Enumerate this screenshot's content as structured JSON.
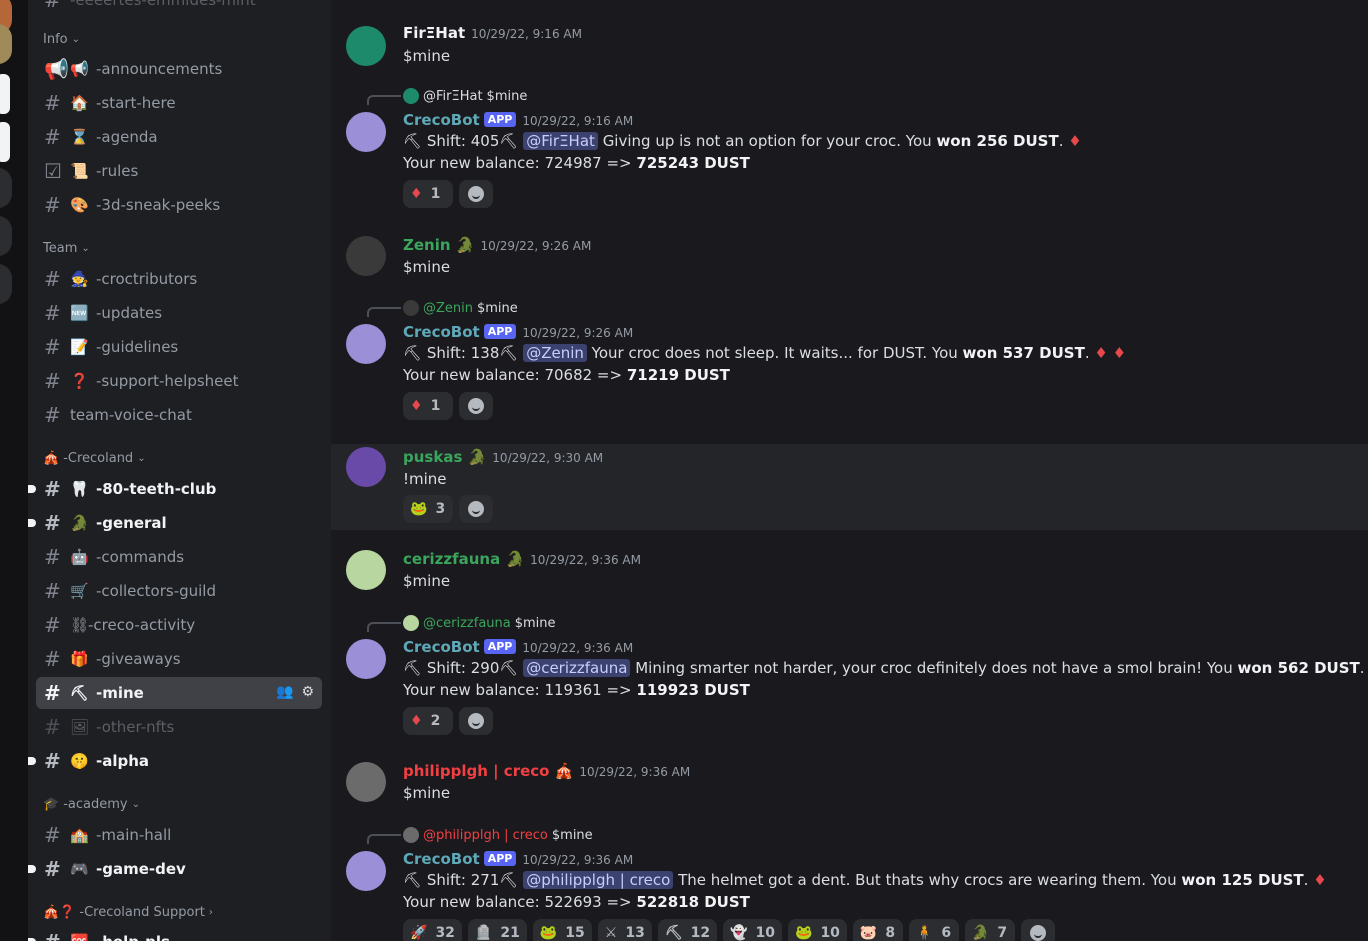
{
  "sidebar": {
    "cut_label": "-eeeertes-emmides-mint",
    "categories": [
      {
        "label": "Info"
      },
      {
        "label": "Team"
      },
      {
        "label": "-Crecoland",
        "emoji": "🎪"
      },
      {
        "label": "-academy",
        "emoji": "🎓"
      },
      {
        "label": "-Crecoland Support",
        "emoji": "🎪❓"
      }
    ],
    "channels": [
      {
        "emoji": "📢",
        "label": "-announcements",
        "icon": "megaphone-icon"
      },
      {
        "emoji": "🏠",
        "label": "-start-here"
      },
      {
        "emoji": "⌛",
        "label": "-agenda"
      },
      {
        "emoji": "📜",
        "label": "-rules",
        "icon": "checkbox-icon"
      },
      {
        "emoji": "🎨",
        "label": "-3d-sneak-peeks"
      },
      {
        "emoji": "🧙",
        "label": "-croctributors"
      },
      {
        "emoji": "🆕",
        "label": "-updates"
      },
      {
        "emoji": "📝",
        "label": "-guidelines"
      },
      {
        "emoji": "❓",
        "label": "-support-helpsheet"
      },
      {
        "emoji": "",
        "label": "team-voice-chat"
      },
      {
        "emoji": "🦷",
        "label": "-80-teeth-club"
      },
      {
        "emoji": "🐊",
        "label": "-general"
      },
      {
        "emoji": "🤖",
        "label": "-commands"
      },
      {
        "emoji": "🛒",
        "label": "-collectors-guild"
      },
      {
        "emoji": "⛓",
        "label": "-creco-activity"
      },
      {
        "emoji": "🎁",
        "label": "-giveaways"
      },
      {
        "emoji": "⛏",
        "label": "-mine"
      },
      {
        "emoji": "🖼",
        "label": "-other-nfts"
      },
      {
        "emoji": "🤫",
        "label": "-alpha"
      },
      {
        "emoji": "🏫",
        "label": "-main-hall"
      },
      {
        "emoji": "🎮",
        "label": "-game-dev"
      },
      {
        "emoji": "🆘",
        "label": "-help-pls"
      }
    ]
  },
  "messages": [
    {
      "author": "FirΞHat",
      "color": "#f2f3f5",
      "time": "10/29/22, 9:16 AM",
      "text": "$mine"
    },
    {
      "reply_to": "@FirΞHat",
      "reply_text": "$mine",
      "author": "CrecoBot",
      "tag": "APP",
      "time": "10/29/22, 9:16 AM",
      "shift": "Shift: 405",
      "mention": "@FirΞHat",
      "body": "Giving up is not an option for your croc. You",
      "won": "won 256 DUST",
      "gems": "1",
      "balance": "Your new balance: 724987 =>",
      "new_balance": "725243 DUST",
      "reaction_count": "1"
    },
    {
      "author": "Zenin",
      "color": "#3ba55d",
      "time": "10/29/22, 9:26 AM",
      "text": "$mine"
    },
    {
      "reply_to": "@Zenin",
      "reply_text": "$mine",
      "author": "CrecoBot",
      "tag": "APP",
      "time": "10/29/22, 9:26 AM",
      "shift": "Shift: 138",
      "mention": "@Zenin",
      "body": "Your croc does not sleep. It waits... for DUST. You",
      "won": "won 537 DUST",
      "gems": "2",
      "balance": "Your new balance: 70682 =>",
      "new_balance": "71219 DUST",
      "reaction_count": "1"
    },
    {
      "author": "puskas",
      "color": "#3ba55d",
      "time": "10/29/22, 9:30 AM",
      "text": "!mine",
      "reaction_count": "3"
    },
    {
      "author": "cerizzfauna",
      "color": "#3ba55d",
      "time": "10/29/22, 9:36 AM",
      "text": "$mine"
    },
    {
      "reply_to": "@cerizzfauna",
      "reply_text": "$mine",
      "author": "CrecoBot",
      "tag": "APP",
      "time": "10/29/22, 9:36 AM",
      "shift": "Shift: 290",
      "mention": "@cerizzfauna",
      "body": "Mining smarter not harder, your croc definitely does not have a smol brain! You",
      "won": "won 562 DUST",
      "gems": "2",
      "balance": "Your new balance: 119361 =>",
      "new_balance": "119923 DUST",
      "reaction_count": "2"
    },
    {
      "author": "philipplgh | creco",
      "color": "#f23f42",
      "time": "10/29/22, 9:36 AM",
      "text": "$mine"
    },
    {
      "reply_to": "@philipplgh | creco",
      "reply_text": "$mine",
      "author": "CrecoBot",
      "tag": "APP",
      "time": "10/29/22, 9:36 AM",
      "shift": "Shift: 271",
      "mention": "@philipplgh | creco",
      "body": "The helmet got a dent. But thats why crocs are wearing them. You",
      "won": "won 125 DUST",
      "gems": "1",
      "balance": "Your new balance: 522693 =>",
      "new_balance": "522818 DUST"
    }
  ],
  "last_reactions": [
    {
      "emoji": "🚀",
      "count": "32"
    },
    {
      "emoji": "🪦",
      "count": "21"
    },
    {
      "emoji": "🐸",
      "count": "15"
    },
    {
      "emoji": "⚔",
      "count": "13"
    },
    {
      "emoji": "⛏",
      "count": "12"
    },
    {
      "emoji": "👻",
      "count": "10"
    },
    {
      "emoji": "🐸",
      "count": "10"
    },
    {
      "emoji": "🐷",
      "count": "8"
    },
    {
      "emoji": "🧍",
      "count": "6"
    },
    {
      "emoji": "🐊",
      "count": "7"
    }
  ],
  "colors": {
    "accent": "#5865f2",
    "bot_name": "#5fa8b8",
    "mention_bg": "#3c4270",
    "gem": "#e5484d"
  }
}
